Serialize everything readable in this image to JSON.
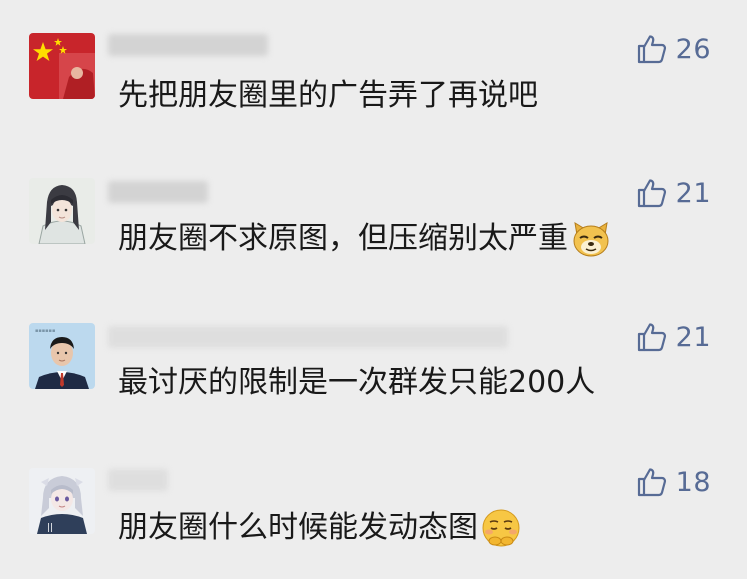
{
  "comments": [
    {
      "likes": "26",
      "text": "先把朋友圈里的广告弄了再说吧",
      "emoji": null
    },
    {
      "likes": "21",
      "text": "朋友圈不求原图，但压缩别太严重",
      "emoji": "doge-emoji-icon"
    },
    {
      "likes": "21",
      "text": "最讨厌的限制是一次群发只能200人",
      "emoji": null
    },
    {
      "likes": "18",
      "text": "朋友圈什么时候能发动态图",
      "emoji": "sad-pleading-emoji-icon"
    }
  ],
  "colors": {
    "background": "#ededed",
    "like_blue": "#576b95",
    "text": "#191919"
  }
}
